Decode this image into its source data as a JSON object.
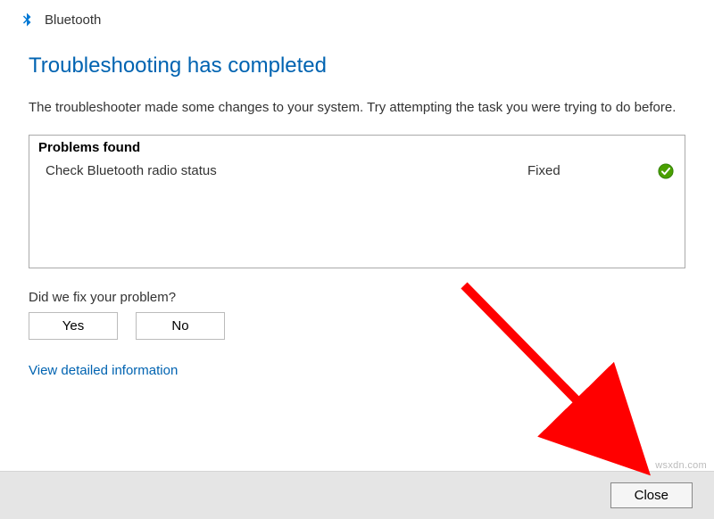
{
  "titlebar": {
    "app_name": "Bluetooth"
  },
  "heading": "Troubleshooting has completed",
  "description": "The troubleshooter made some changes to your system. Try attempting the task you were trying to do before.",
  "problems": {
    "header": "Problems found",
    "items": [
      {
        "name": "Check Bluetooth radio status",
        "status": "Fixed",
        "icon": "fixed-check"
      }
    ]
  },
  "fix_question": "Did we fix your problem?",
  "buttons": {
    "yes": "Yes",
    "no": "No"
  },
  "detailed_link": "View detailed information",
  "footer": {
    "close": "Close"
  },
  "watermark": "wsxdn.com",
  "colors": {
    "accent": "#0063b1"
  }
}
